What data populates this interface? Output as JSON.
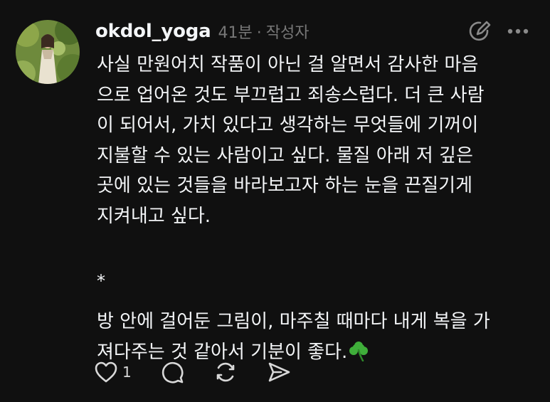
{
  "post": {
    "username": "okdol_yoga",
    "time": "41분",
    "separator": "·",
    "author_badge": "작성자",
    "paragraph1": "사실 만원어치 작품이 아닌 걸 알면서 감사한 마음\n으로 업어온 것도 부끄럽고 죄송스럽다. 더 큰 사람\n이 되어서, 가치 있다고 생각하는 무엇들에 기꺼이\n지불할 수 있는 사람이고 싶다. 물질 아래 저 깊은\n곳에 있는 것들을 바라보고자 하는 눈을 끈질기게\n지켜내고 싶다.",
    "divider": "*",
    "paragraph2": "방 안에 걸어둔 그림이, 마주칠 때마다 내게 복을 가\n져다주는 것 같아서 기분이 좋다.",
    "emoji_icon": "shamrock-icon"
  },
  "actions": {
    "like_count": "1",
    "icons": [
      "heart-icon",
      "comment-icon",
      "repost-icon",
      "share-icon"
    ]
  },
  "header_icons": [
    "edit-icon",
    "more-icon"
  ],
  "colors": {
    "background": "#101010",
    "text": "#f3f5f7",
    "muted": "#777777"
  }
}
